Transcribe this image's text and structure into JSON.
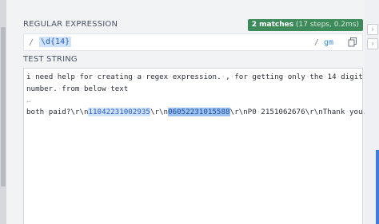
{
  "regex_section": {
    "label": "REGULAR EXPRESSION",
    "delimiter_open": "/",
    "pattern": "\\d{14}",
    "delimiter_close": "/",
    "flags": "gm"
  },
  "match_info": {
    "count": "2 matches",
    "details": "(17 steps, 0.2ms)"
  },
  "test_section": {
    "label": "TEST STRING",
    "line1_words": [
      "i",
      "need",
      "help",
      "for",
      "creating",
      "a",
      "regex",
      "expression.",
      ",",
      "for",
      "getting",
      "only",
      "the",
      "14",
      "digit"
    ],
    "line2_words": [
      "number.",
      "from",
      "below",
      "text"
    ],
    "line4_before": "both",
    "line4_text1": "paid?\\r\\n",
    "match1": "11042231002935",
    "line4_text2": "\\r\\n",
    "match2": "06052231015588",
    "line4_text3": "\\r\\nP0",
    "line4_text4": "2151062676\\r\\nThank",
    "line4_text5": "you."
  },
  "colors": {
    "badge": "#3d8b5a",
    "match_highlight": "#cfe3fb",
    "match_text": "#2b5bbf",
    "accent": "#3e7dde"
  },
  "icons": {
    "copy": "copy-icon",
    "return": "return-icon"
  }
}
